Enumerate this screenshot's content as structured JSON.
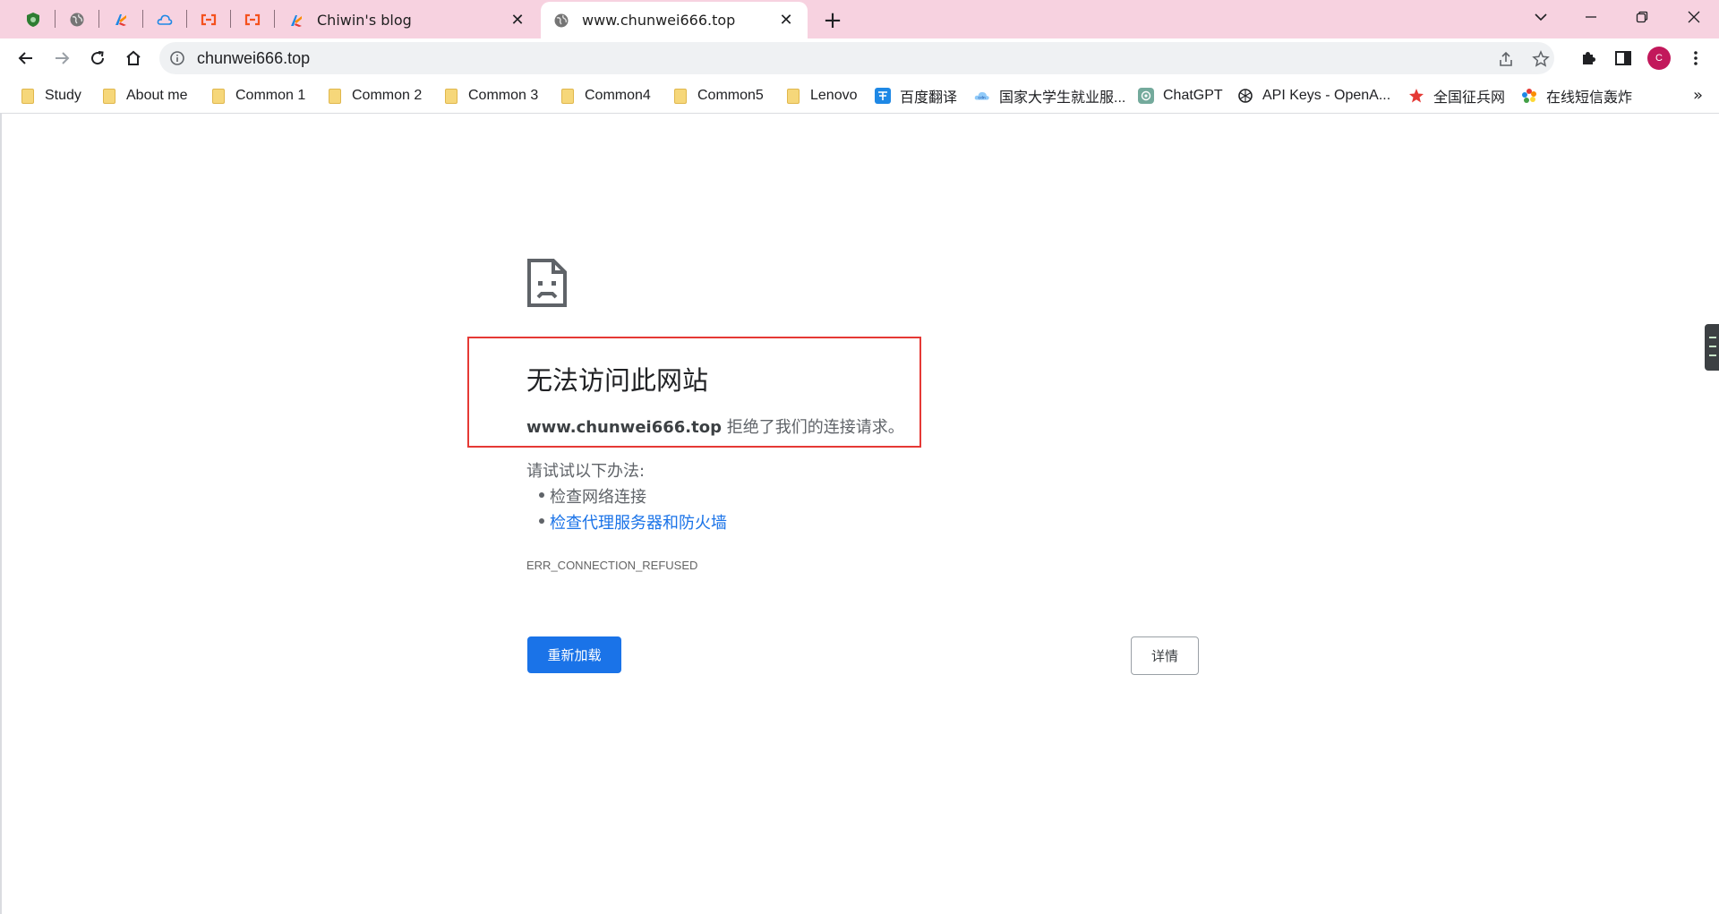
{
  "tabs": {
    "pinned": [
      {
        "icon": "shield-green-icon"
      },
      {
        "icon": "globe-icon"
      },
      {
        "icon": "colorful-logo-icon"
      },
      {
        "icon": "cloud-icon"
      },
      {
        "icon": "orange-bracket-icon"
      },
      {
        "icon": "orange-bracket-icon"
      }
    ],
    "items": [
      {
        "title": "Chiwin's blog",
        "icon": "colorful-logo-icon",
        "active": false
      },
      {
        "title": "www.chunwei666.top",
        "icon": "globe-icon",
        "active": true
      }
    ],
    "new_tab_label": "+"
  },
  "toolbar": {
    "url": "chunwei666.top",
    "avatar_letter": "C",
    "avatar_color": "#c2185b"
  },
  "bookmarks": [
    {
      "label": "Study",
      "icon": "folder-icon"
    },
    {
      "label": "About me",
      "icon": "folder-icon"
    },
    {
      "label": "Common 1",
      "icon": "folder-icon"
    },
    {
      "label": "Common 2",
      "icon": "folder-icon"
    },
    {
      "label": "Common 3",
      "icon": "folder-icon"
    },
    {
      "label": "Common4",
      "icon": "folder-icon"
    },
    {
      "label": "Common5",
      "icon": "folder-icon"
    },
    {
      "label": "Lenovo",
      "icon": "folder-icon"
    },
    {
      "label": "百度翻译",
      "icon": "baidu-translate-icon"
    },
    {
      "label": "国家大学生就业服...",
      "icon": "cloud-service-icon"
    },
    {
      "label": "ChatGPT",
      "icon": "chatgpt-icon"
    },
    {
      "label": "API Keys - OpenA...",
      "icon": "openai-icon"
    },
    {
      "label": "全国征兵网",
      "icon": "red-star-icon"
    },
    {
      "label": "在线短信轰炸",
      "icon": "colorful-wheel-icon"
    }
  ],
  "bookmarks_overflow": "»",
  "error_page": {
    "title": "无法访问此网站",
    "host": "www.chunwei666.top",
    "message": " 拒绝了我们的连接请求。",
    "try_label": "请试试以下办法:",
    "suggestions": [
      "检查网络连接",
      "检查代理服务器和防火墙"
    ],
    "error_code": "ERR_CONNECTION_REFUSED",
    "reload_label": "重新加载",
    "details_label": "详情"
  },
  "colors": {
    "tabstrip_bg": "#f7d2e0",
    "link": "#1a73e8",
    "primary_button": "#1a73e8",
    "annotation_box": "#e53935"
  }
}
